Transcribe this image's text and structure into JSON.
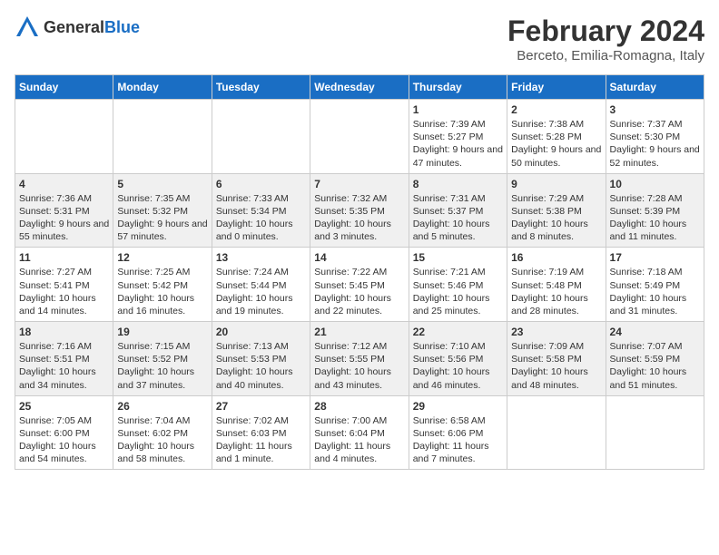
{
  "logo": {
    "general": "General",
    "blue": "Blue"
  },
  "title": "February 2024",
  "subtitle": "Berceto, Emilia-Romagna, Italy",
  "days_of_week": [
    "Sunday",
    "Monday",
    "Tuesday",
    "Wednesday",
    "Thursday",
    "Friday",
    "Saturday"
  ],
  "weeks": [
    [
      {
        "day": "",
        "info": ""
      },
      {
        "day": "",
        "info": ""
      },
      {
        "day": "",
        "info": ""
      },
      {
        "day": "",
        "info": ""
      },
      {
        "day": "1",
        "info": "Sunrise: 7:39 AM\nSunset: 5:27 PM\nDaylight: 9 hours and 47 minutes."
      },
      {
        "day": "2",
        "info": "Sunrise: 7:38 AM\nSunset: 5:28 PM\nDaylight: 9 hours and 50 minutes."
      },
      {
        "day": "3",
        "info": "Sunrise: 7:37 AM\nSunset: 5:30 PM\nDaylight: 9 hours and 52 minutes."
      }
    ],
    [
      {
        "day": "4",
        "info": "Sunrise: 7:36 AM\nSunset: 5:31 PM\nDaylight: 9 hours and 55 minutes."
      },
      {
        "day": "5",
        "info": "Sunrise: 7:35 AM\nSunset: 5:32 PM\nDaylight: 9 hours and 57 minutes."
      },
      {
        "day": "6",
        "info": "Sunrise: 7:33 AM\nSunset: 5:34 PM\nDaylight: 10 hours and 0 minutes."
      },
      {
        "day": "7",
        "info": "Sunrise: 7:32 AM\nSunset: 5:35 PM\nDaylight: 10 hours and 3 minutes."
      },
      {
        "day": "8",
        "info": "Sunrise: 7:31 AM\nSunset: 5:37 PM\nDaylight: 10 hours and 5 minutes."
      },
      {
        "day": "9",
        "info": "Sunrise: 7:29 AM\nSunset: 5:38 PM\nDaylight: 10 hours and 8 minutes."
      },
      {
        "day": "10",
        "info": "Sunrise: 7:28 AM\nSunset: 5:39 PM\nDaylight: 10 hours and 11 minutes."
      }
    ],
    [
      {
        "day": "11",
        "info": "Sunrise: 7:27 AM\nSunset: 5:41 PM\nDaylight: 10 hours and 14 minutes."
      },
      {
        "day": "12",
        "info": "Sunrise: 7:25 AM\nSunset: 5:42 PM\nDaylight: 10 hours and 16 minutes."
      },
      {
        "day": "13",
        "info": "Sunrise: 7:24 AM\nSunset: 5:44 PM\nDaylight: 10 hours and 19 minutes."
      },
      {
        "day": "14",
        "info": "Sunrise: 7:22 AM\nSunset: 5:45 PM\nDaylight: 10 hours and 22 minutes."
      },
      {
        "day": "15",
        "info": "Sunrise: 7:21 AM\nSunset: 5:46 PM\nDaylight: 10 hours and 25 minutes."
      },
      {
        "day": "16",
        "info": "Sunrise: 7:19 AM\nSunset: 5:48 PM\nDaylight: 10 hours and 28 minutes."
      },
      {
        "day": "17",
        "info": "Sunrise: 7:18 AM\nSunset: 5:49 PM\nDaylight: 10 hours and 31 minutes."
      }
    ],
    [
      {
        "day": "18",
        "info": "Sunrise: 7:16 AM\nSunset: 5:51 PM\nDaylight: 10 hours and 34 minutes."
      },
      {
        "day": "19",
        "info": "Sunrise: 7:15 AM\nSunset: 5:52 PM\nDaylight: 10 hours and 37 minutes."
      },
      {
        "day": "20",
        "info": "Sunrise: 7:13 AM\nSunset: 5:53 PM\nDaylight: 10 hours and 40 minutes."
      },
      {
        "day": "21",
        "info": "Sunrise: 7:12 AM\nSunset: 5:55 PM\nDaylight: 10 hours and 43 minutes."
      },
      {
        "day": "22",
        "info": "Sunrise: 7:10 AM\nSunset: 5:56 PM\nDaylight: 10 hours and 46 minutes."
      },
      {
        "day": "23",
        "info": "Sunrise: 7:09 AM\nSunset: 5:58 PM\nDaylight: 10 hours and 48 minutes."
      },
      {
        "day": "24",
        "info": "Sunrise: 7:07 AM\nSunset: 5:59 PM\nDaylight: 10 hours and 51 minutes."
      }
    ],
    [
      {
        "day": "25",
        "info": "Sunrise: 7:05 AM\nSunset: 6:00 PM\nDaylight: 10 hours and 54 minutes."
      },
      {
        "day": "26",
        "info": "Sunrise: 7:04 AM\nSunset: 6:02 PM\nDaylight: 10 hours and 58 minutes."
      },
      {
        "day": "27",
        "info": "Sunrise: 7:02 AM\nSunset: 6:03 PM\nDaylight: 11 hours and 1 minute."
      },
      {
        "day": "28",
        "info": "Sunrise: 7:00 AM\nSunset: 6:04 PM\nDaylight: 11 hours and 4 minutes."
      },
      {
        "day": "29",
        "info": "Sunrise: 6:58 AM\nSunset: 6:06 PM\nDaylight: 11 hours and 7 minutes."
      },
      {
        "day": "",
        "info": ""
      },
      {
        "day": "",
        "info": ""
      }
    ]
  ]
}
